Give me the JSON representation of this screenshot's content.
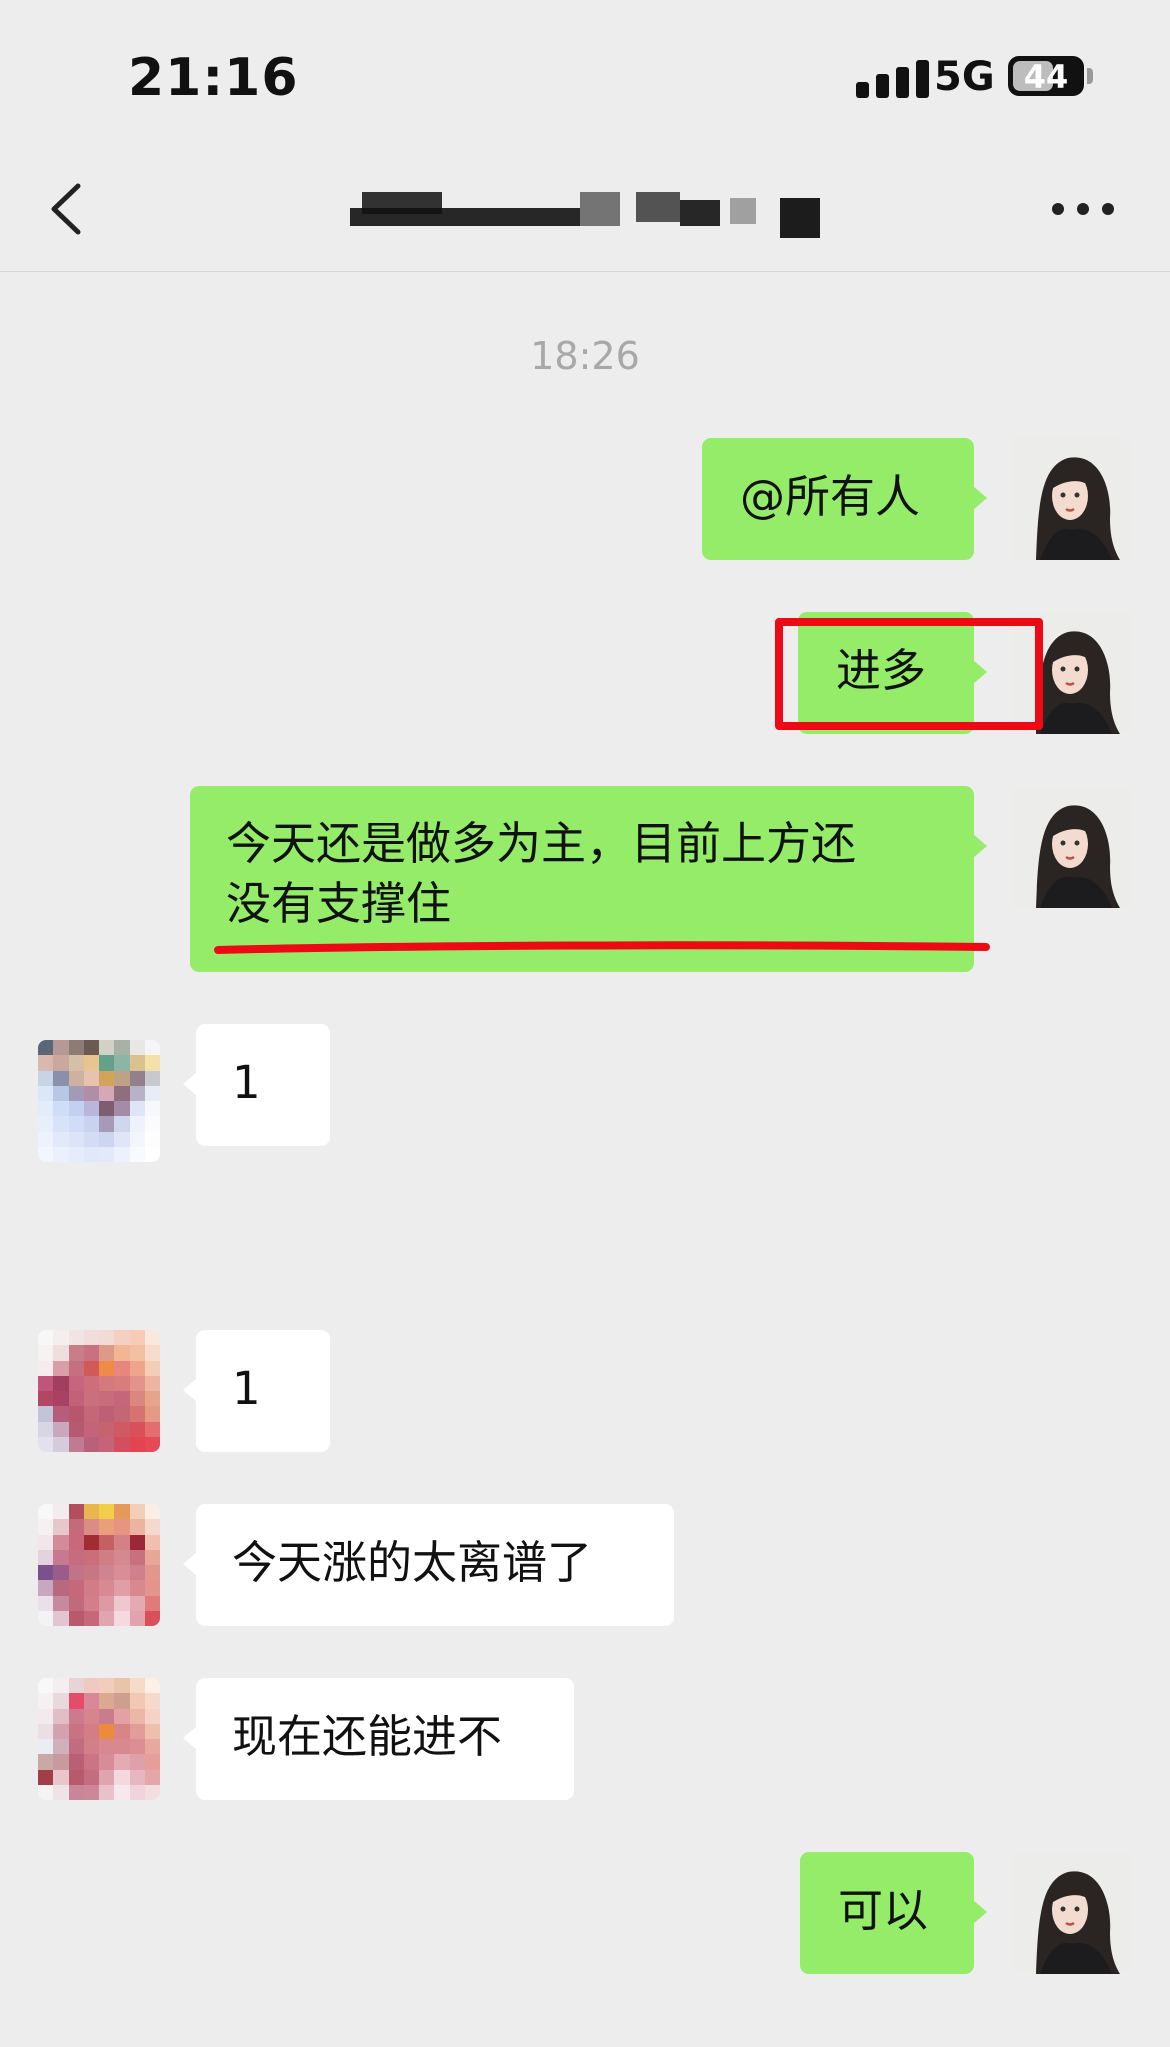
{
  "status_bar": {
    "time": "21:16",
    "network": "5G",
    "battery": "44"
  },
  "nav": {
    "back_icon": "chevron-left-icon",
    "more_icon": "more-dots-icon"
  },
  "chat": {
    "timestamp": "18:26",
    "messages": [
      {
        "direction": "out",
        "text": "@所有人"
      },
      {
        "direction": "out",
        "text": "进多",
        "annotation": "red-box"
      },
      {
        "direction": "out",
        "lines": [
          "今天还是做多为主，目前上方还",
          "没有支撑住"
        ],
        "annotation": "red-underline"
      },
      {
        "direction": "in",
        "text": "1"
      },
      {
        "direction": "in",
        "text": "1"
      },
      {
        "direction": "in",
        "text": "今天涨的太离谱了"
      },
      {
        "direction": "in",
        "text": "现在还能进不"
      },
      {
        "direction": "out",
        "text": "可以"
      }
    ]
  },
  "colors": {
    "outgoing_bubble": "#95ec69",
    "incoming_bubble": "#ffffff",
    "background": "#ededed",
    "annotation_red": "#ee0a14"
  }
}
